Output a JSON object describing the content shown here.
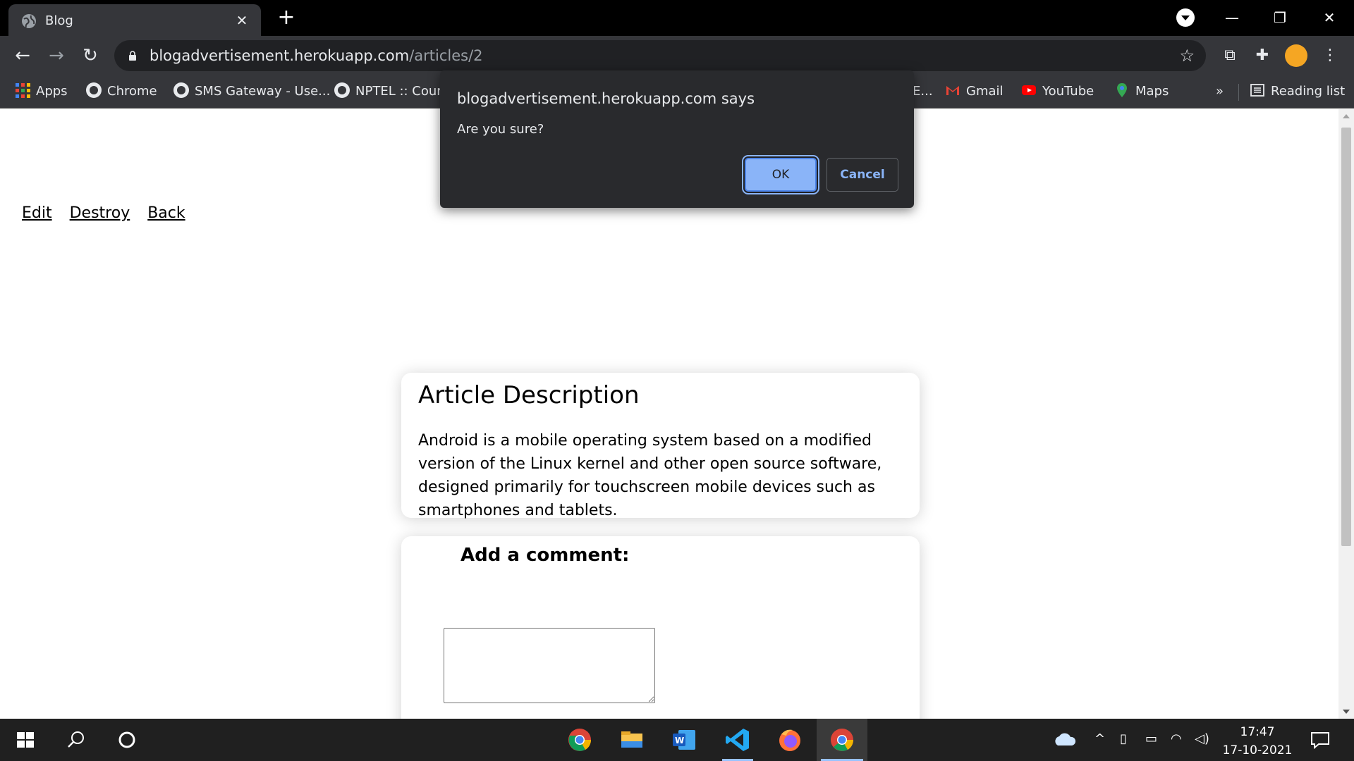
{
  "tab": {
    "title": "Blog",
    "close": "✕"
  },
  "toolbar": {
    "url_host": "blogadvertisement.herokuapp.com",
    "url_path": "/articles/2"
  },
  "bookmarks": [
    {
      "label": "Apps",
      "icon": "apps-grid-icon"
    },
    {
      "label": "Chrome",
      "icon": "globe-icon"
    },
    {
      "label": "SMS Gateway - Use...",
      "icon": "globe-icon"
    },
    {
      "label": "NPTEL :: Cours",
      "icon": "globe-icon"
    },
    {
      "label": "E...",
      "icon": "none"
    },
    {
      "label": "Gmail",
      "icon": "gmail-icon"
    },
    {
      "label": "YouTube",
      "icon": "youtube-icon"
    },
    {
      "label": "Maps",
      "icon": "maps-icon"
    }
  ],
  "bookmarks_overflow": "»",
  "reading_list": "Reading list",
  "page": {
    "links": [
      "Edit",
      "Destroy",
      "Back"
    ],
    "article": {
      "heading": "Article Description",
      "body": "Android is a mobile operating system based on a modified version of the Linux kernel and other open source software, designed primarily for touchscreen mobile devices such as smartphones and tablets."
    },
    "comment": {
      "label": "Add a comment:"
    }
  },
  "dialog": {
    "title": "blogadvertisement.herokuapp.com says",
    "message": "Are you sure?",
    "ok": "OK",
    "cancel": "Cancel"
  },
  "taskbar": {
    "time": "17:47",
    "date": "17-10-2021"
  },
  "colors": {
    "accent": "#8ab4f8",
    "chrome_dark": "#35363a",
    "dialog_bg": "#292a2d"
  }
}
